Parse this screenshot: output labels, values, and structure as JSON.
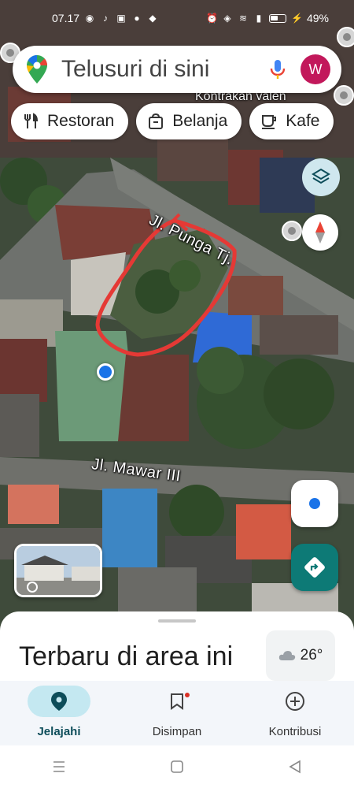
{
  "status_bar": {
    "time": "07.17",
    "battery_percent": "49%"
  },
  "search": {
    "placeholder": "Telusuri di sini",
    "avatar_initial": "W"
  },
  "chips": [
    {
      "label": "Restoran",
      "icon": "restaurant-icon"
    },
    {
      "label": "Belanja",
      "icon": "shopping-bag-icon"
    },
    {
      "label": "Kafe",
      "icon": "cafe-icon"
    }
  ],
  "map": {
    "place_label": "Kontrakan valen",
    "streets": {
      "punga": "Jl. Punga Tj.",
      "mawar": "Jl. Mawar III"
    }
  },
  "sheet": {
    "title": "Terbaru di area ini",
    "weather_temp": "26°",
    "weather_icon": "cloud-icon"
  },
  "bottom_nav": [
    {
      "label": "Jelajahi",
      "icon": "explore-pin-icon",
      "active": true
    },
    {
      "label": "Disimpan",
      "icon": "bookmark-icon",
      "active": false
    },
    {
      "label": "Kontribusi",
      "icon": "add-circle-icon",
      "active": false
    }
  ],
  "colors": {
    "accent": "#0d7a76",
    "avatar": "#c2185b",
    "highlight_stroke": "#e53935",
    "user_dot": "#1a73e8"
  }
}
